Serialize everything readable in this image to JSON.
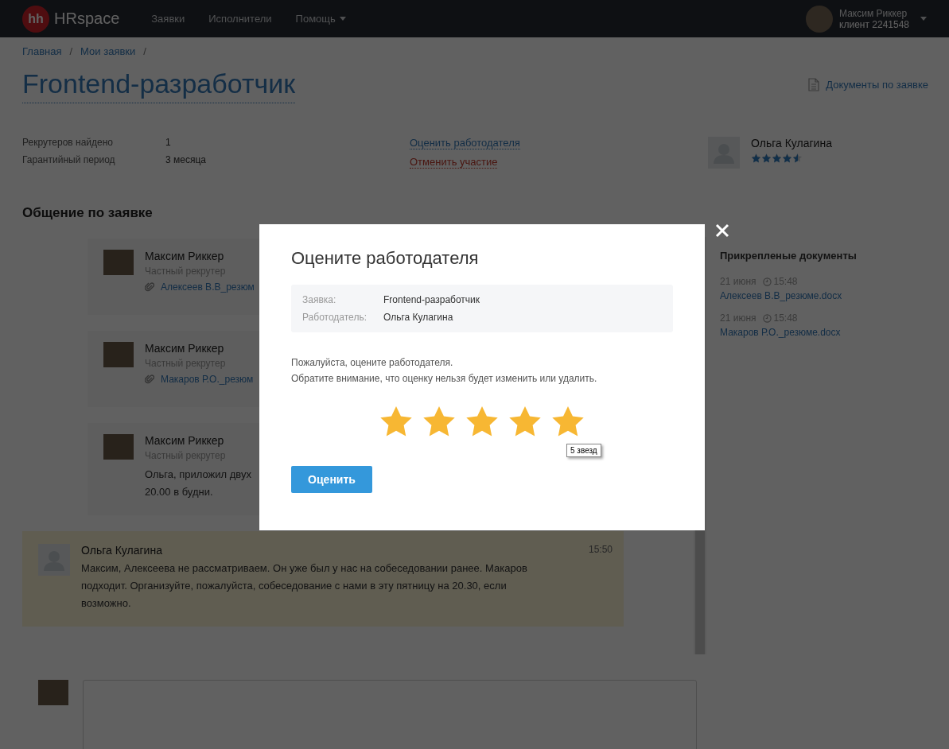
{
  "header": {
    "logo_mark": "hh",
    "logo_text": "HRspace",
    "nav": [
      {
        "label": "Заявки",
        "has_menu": false
      },
      {
        "label": "Исполнители",
        "has_menu": false
      },
      {
        "label": "Помощь",
        "has_menu": true
      }
    ],
    "user": {
      "name": "Максим Риккер",
      "subtitle": "клиент 2241548"
    }
  },
  "breadcrumbs": [
    {
      "label": "Главная",
      "separator": "/"
    },
    {
      "label": "Мои заявки",
      "separator": "/"
    }
  ],
  "title": "Frontend-разработчик",
  "documents_link": "Документы по заявке",
  "details": [
    {
      "label": "Рекрутеров найдено",
      "value": "1"
    },
    {
      "label": "Гарантийный период",
      "value": "3 месяца"
    }
  ],
  "actions": [
    {
      "label": "Оценить работодателя",
      "kind": "primary"
    },
    {
      "label": "Отменить участие",
      "kind": "danger"
    }
  ],
  "employer": {
    "name": "Ольга Кулагина",
    "stars": 4.5
  },
  "chat": {
    "title": "Общение по заявке",
    "messages": [
      {
        "kind": "recruiter",
        "author": "Максим Риккер",
        "role": "Частный рекрутер",
        "attachment": "Алексеев В.В_резюм"
      },
      {
        "kind": "recruiter",
        "author": "Максим Риккер",
        "role": "Частный рекрутер",
        "attachment": "Макаров Р.О._резюм"
      },
      {
        "kind": "recruiter",
        "author": "Максим Риккер",
        "role": "Частный рекрутер",
        "lines": [
          "Ольга, приложил двух",
          "20.00 в будни."
        ]
      },
      {
        "kind": "employer",
        "author": "Ольга Кулагина",
        "time": "15:50",
        "lines": [
          "Максим, Алексеева не рассматриваем. Он уже был у нас на собеседовании ранее. Макаров подходит. Организуйте, пожалуйста, собеседование с нами в эту пятницу на 20.30, если возможно."
        ]
      }
    ]
  },
  "attachments": {
    "title": "Прикрепленые документы",
    "files": [
      {
        "date": "21 июня",
        "time": "15:48",
        "name": "Алексеев В.В_резюме.docx"
      },
      {
        "date": "21 июня",
        "time": "15:48",
        "name": "Макаров Р.О._резюме.docx"
      }
    ]
  },
  "modal": {
    "title": "Оцените работодателя",
    "fields": [
      {
        "label": "Заявка:",
        "value": "Frontend-разработчик"
      },
      {
        "label": "Работодатель:",
        "value": "Ольга Кулагина"
      }
    ],
    "notice": [
      "Пожалуйста, оцените работодателя.",
      "Обратите внимание, что оценку нельзя будет изменить или удалить."
    ],
    "stars": 5,
    "tooltip": "5 звезд",
    "submit": "Оценить"
  }
}
